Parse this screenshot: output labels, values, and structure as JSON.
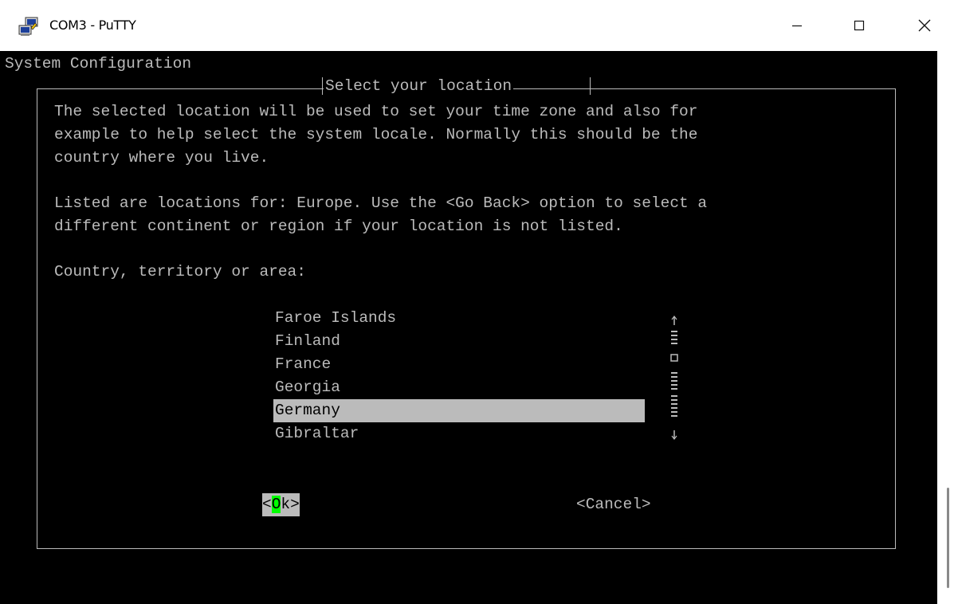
{
  "window": {
    "title": "COM3 - PuTTY",
    "icon": "putty-icon",
    "controls": {
      "minimize": "minimize-icon",
      "maximize": "maximize-icon",
      "close": "close-icon"
    }
  },
  "terminal": {
    "header": "System Configuration",
    "dialog_title": "Select your location",
    "paragraph1": [
      "The selected location will be used to set your time zone and also for",
      "example to help select the system locale. Normally this should be the",
      "country where you live."
    ],
    "paragraph2": [
      "Listed are locations for: Europe. Use the <Go Back> option to select a",
      "different continent or region if your location is not listed."
    ],
    "prompt": "Country, territory or area:",
    "countries": [
      "Faroe Islands",
      "Finland",
      "France",
      "Georgia",
      "Germany",
      "Gibraltar"
    ],
    "selected": "Germany",
    "buttons": {
      "ok_open": "<",
      "ok_hotkey": "O",
      "ok_rest": "k>",
      "cancel": "<Cancel>"
    }
  },
  "colors": {
    "terminal_bg": "#000000",
    "terminal_fg": "#bbbbbb",
    "selection_bg": "#bbbbbb",
    "hotkey": "#00ff00"
  }
}
